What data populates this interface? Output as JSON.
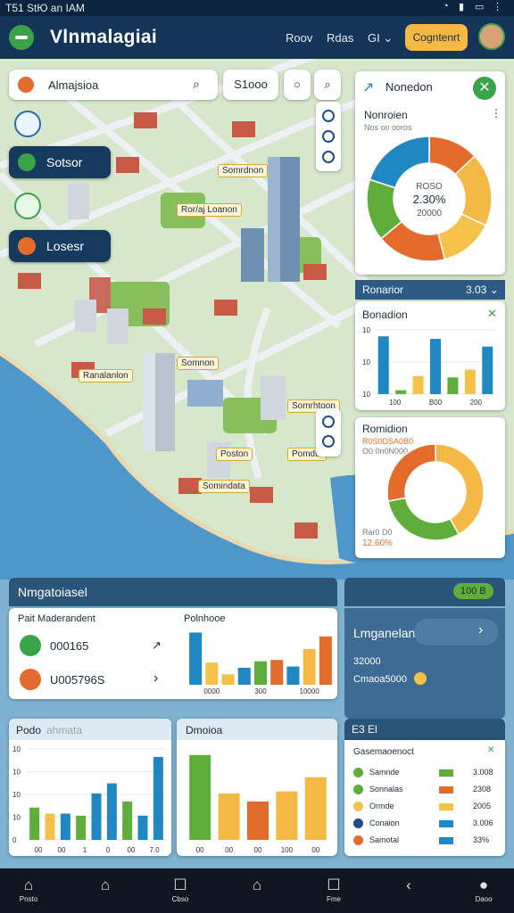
{
  "status": {
    "time": "T51 StЮ an IAM"
  },
  "header": {
    "title": "Vlnmalagiai",
    "nav": [
      "Roov",
      "Rdas",
      "GI ⌄"
    ],
    "cta": "Cogntenrt"
  },
  "map": {
    "search_value": "Almajsioa",
    "chip_value": "S1ooo",
    "buttons": [
      {
        "label": "Sotsor"
      },
      {
        "label": "Losesr"
      }
    ],
    "labels": [
      "Somrdnon",
      "Ror/aj Loanon",
      "Somnon",
      "Ranalanlon",
      "Somrhtoon",
      "Poston",
      "Pomdta",
      "Somindata"
    ]
  },
  "donut_card": {
    "title": "Nonedon",
    "subtitle": "Nonroien",
    "subnote": "Nos oo ooros",
    "center_line1": "ROSO",
    "center_line2": "2.30%",
    "center_line3": "20000",
    "segments": [
      {
        "value": 13,
        "color": "#e36b2c"
      },
      {
        "value": 19,
        "color": "#f4b845"
      },
      {
        "value": 14,
        "color": "#f4c24a"
      },
      {
        "value": 18,
        "color": "#e36b2c"
      },
      {
        "value": 16,
        "color": "#5fae3c"
      },
      {
        "value": 20,
        "color": "#1f87c2"
      }
    ]
  },
  "bar_card": {
    "band_label": "Ronarior",
    "band_value": "3.03 ⌄",
    "title": "Bonadion",
    "y_ticks": [
      "10",
      "10",
      "10"
    ],
    "x_labels": [
      "100",
      "B00",
      "200"
    ],
    "bars": [
      {
        "value": 9,
        "color": "#1f87c2"
      },
      {
        "value": 0.6,
        "color": "#5fae3c"
      },
      {
        "value": 2.8,
        "color": "#f4c24a"
      },
      {
        "value": 8.6,
        "color": "#1f87c2"
      },
      {
        "value": 2.6,
        "color": "#5fae3c"
      },
      {
        "value": 3.8,
        "color": "#f4c24a"
      },
      {
        "value": 7.4,
        "color": "#1f87c2"
      }
    ]
  },
  "ring_card": {
    "title": "Romidion",
    "label_top": "R0S0DSA0B0",
    "label_top2": "O0 0n0N000",
    "label_bottom": "Rar0 D0",
    "label_bottom2": "12.60%",
    "segments": [
      {
        "value": 42,
        "color": "#f4b845"
      },
      {
        "value": 30,
        "color": "#5fae3c"
      },
      {
        "value": 28,
        "color": "#e36b2c"
      }
    ]
  },
  "overview": {
    "title": "Nmgatoiasel",
    "value": "100 B",
    "left_title": "Pait Maderandent",
    "rows": [
      {
        "value": "000165",
        "arrow": "↗",
        "color": "#3aa34a"
      },
      {
        "value": "U005796S",
        "arrow": "›",
        "color": "#e36b2c"
      }
    ],
    "chart_title": "Polnhooe",
    "x_labels": [
      "0000",
      "300",
      "10000"
    ],
    "bars": [
      {
        "value": 8.0,
        "color": "#1f87c2"
      },
      {
        "value": 3.4,
        "color": "#f4c24a"
      },
      {
        "value": 1.6,
        "color": "#f4c24a"
      },
      {
        "value": 2.6,
        "color": "#1f87c2"
      },
      {
        "value": 3.6,
        "color": "#5fae3c"
      },
      {
        "value": 3.8,
        "color": "#e36b2c"
      },
      {
        "value": 2.8,
        "color": "#1f87c2"
      },
      {
        "value": 5.5,
        "color": "#f4b845"
      },
      {
        "value": 7.4,
        "color": "#e36b2c"
      }
    ]
  },
  "summary": {
    "title": "Lmganelan",
    "value1": "32000",
    "value2": "Cmaoa5000"
  },
  "bottom_left": {
    "title": "Podo",
    "title2": "ahmata",
    "y_ticks": [
      "10",
      "10",
      "10",
      "10",
      "0"
    ],
    "x_labels": [
      "00",
      "00",
      "1",
      "0",
      "00",
      "7.0"
    ],
    "bars": [
      {
        "value": 3.2,
        "color": "#5fae3c"
      },
      {
        "value": 2.6,
        "color": "#f4c24a"
      },
      {
        "value": 2.6,
        "color": "#1f87c2"
      },
      {
        "value": 2.4,
        "color": "#5fae3c"
      },
      {
        "value": 4.6,
        "color": "#1f87c2"
      },
      {
        "value": 5.6,
        "color": "#1f87c2"
      },
      {
        "value": 3.8,
        "color": "#5fae3c"
      },
      {
        "value": 2.4,
        "color": "#1f87c2"
      },
      {
        "value": 8.2,
        "color": "#1f87c2"
      }
    ]
  },
  "bottom_mid": {
    "title": "Dmoioa",
    "x_labels": [
      "00",
      "00",
      "00",
      "100",
      "00"
    ],
    "bars": [
      {
        "value": 8.4,
        "color": "#5fae3c"
      },
      {
        "value": 4.6,
        "color": "#f4b845"
      },
      {
        "value": 3.8,
        "color": "#e36b2c"
      },
      {
        "value": 4.8,
        "color": "#f4b845"
      },
      {
        "value": 6.2,
        "color": "#f4b845"
      }
    ]
  },
  "bottom_right": {
    "band": "E3 El",
    "title": "Gasemaoenoct",
    "rows": [
      {
        "name": "Samnde",
        "value": "3.008",
        "dot": "#5fae3c",
        "bar": "#5fae3c"
      },
      {
        "name": "Sonnalas",
        "value": "2308",
        "dot": "#5fae3c",
        "bar": "#e36b2c"
      },
      {
        "name": "Ormde",
        "value": "2005",
        "dot": "#f4c24a",
        "bar": "#f4c24a"
      },
      {
        "name": "Conaion",
        "value": "3.006",
        "dot": "#1d4e8f",
        "bar": "#1f87c2"
      },
      {
        "name": "Samotal",
        "value": "33%",
        "dot": "#e36b2c",
        "bar": "#1f87c2"
      }
    ]
  },
  "navbar": [
    {
      "label": "Pnsto",
      "icon": "⌂"
    },
    {
      "label": "",
      "icon": "⌂"
    },
    {
      "label": "Cbso",
      "icon": "☐"
    },
    {
      "label": "",
      "icon": "⌂"
    },
    {
      "label": "Fme",
      "icon": "☐"
    },
    {
      "label": "",
      "icon": "‹"
    },
    {
      "label": "Daoo",
      "icon": "●"
    }
  ]
}
